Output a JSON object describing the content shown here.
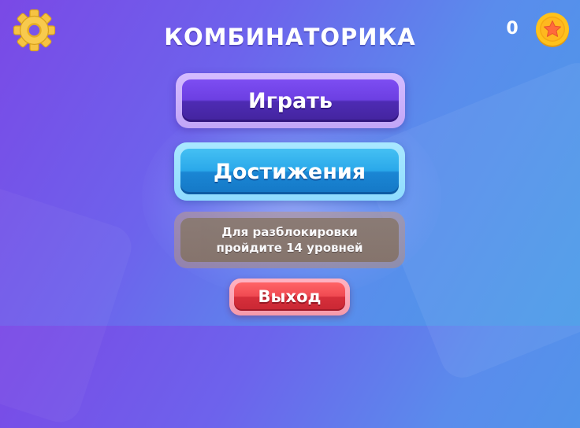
{
  "header": {
    "title": "КОМБИНАТОРИКА",
    "coins": "0",
    "settings_icon": "gear-icon",
    "coin_icon": "star-coin-icon"
  },
  "menu": {
    "play_label": "Играть",
    "achievements_label": "Достижения",
    "locked_line1": "Для разблокировки",
    "locked_line2": "пройдите 14 уровней",
    "exit_label": "Выход"
  },
  "colors": {
    "background_start": "#7a49e6",
    "background_end": "#4a9be8",
    "play": "#6c3fe2",
    "achievements": "#2aa8ea",
    "locked": "#857369",
    "exit": "#f04a52",
    "gear": "#f6c343",
    "coin": "#ffc21c"
  }
}
